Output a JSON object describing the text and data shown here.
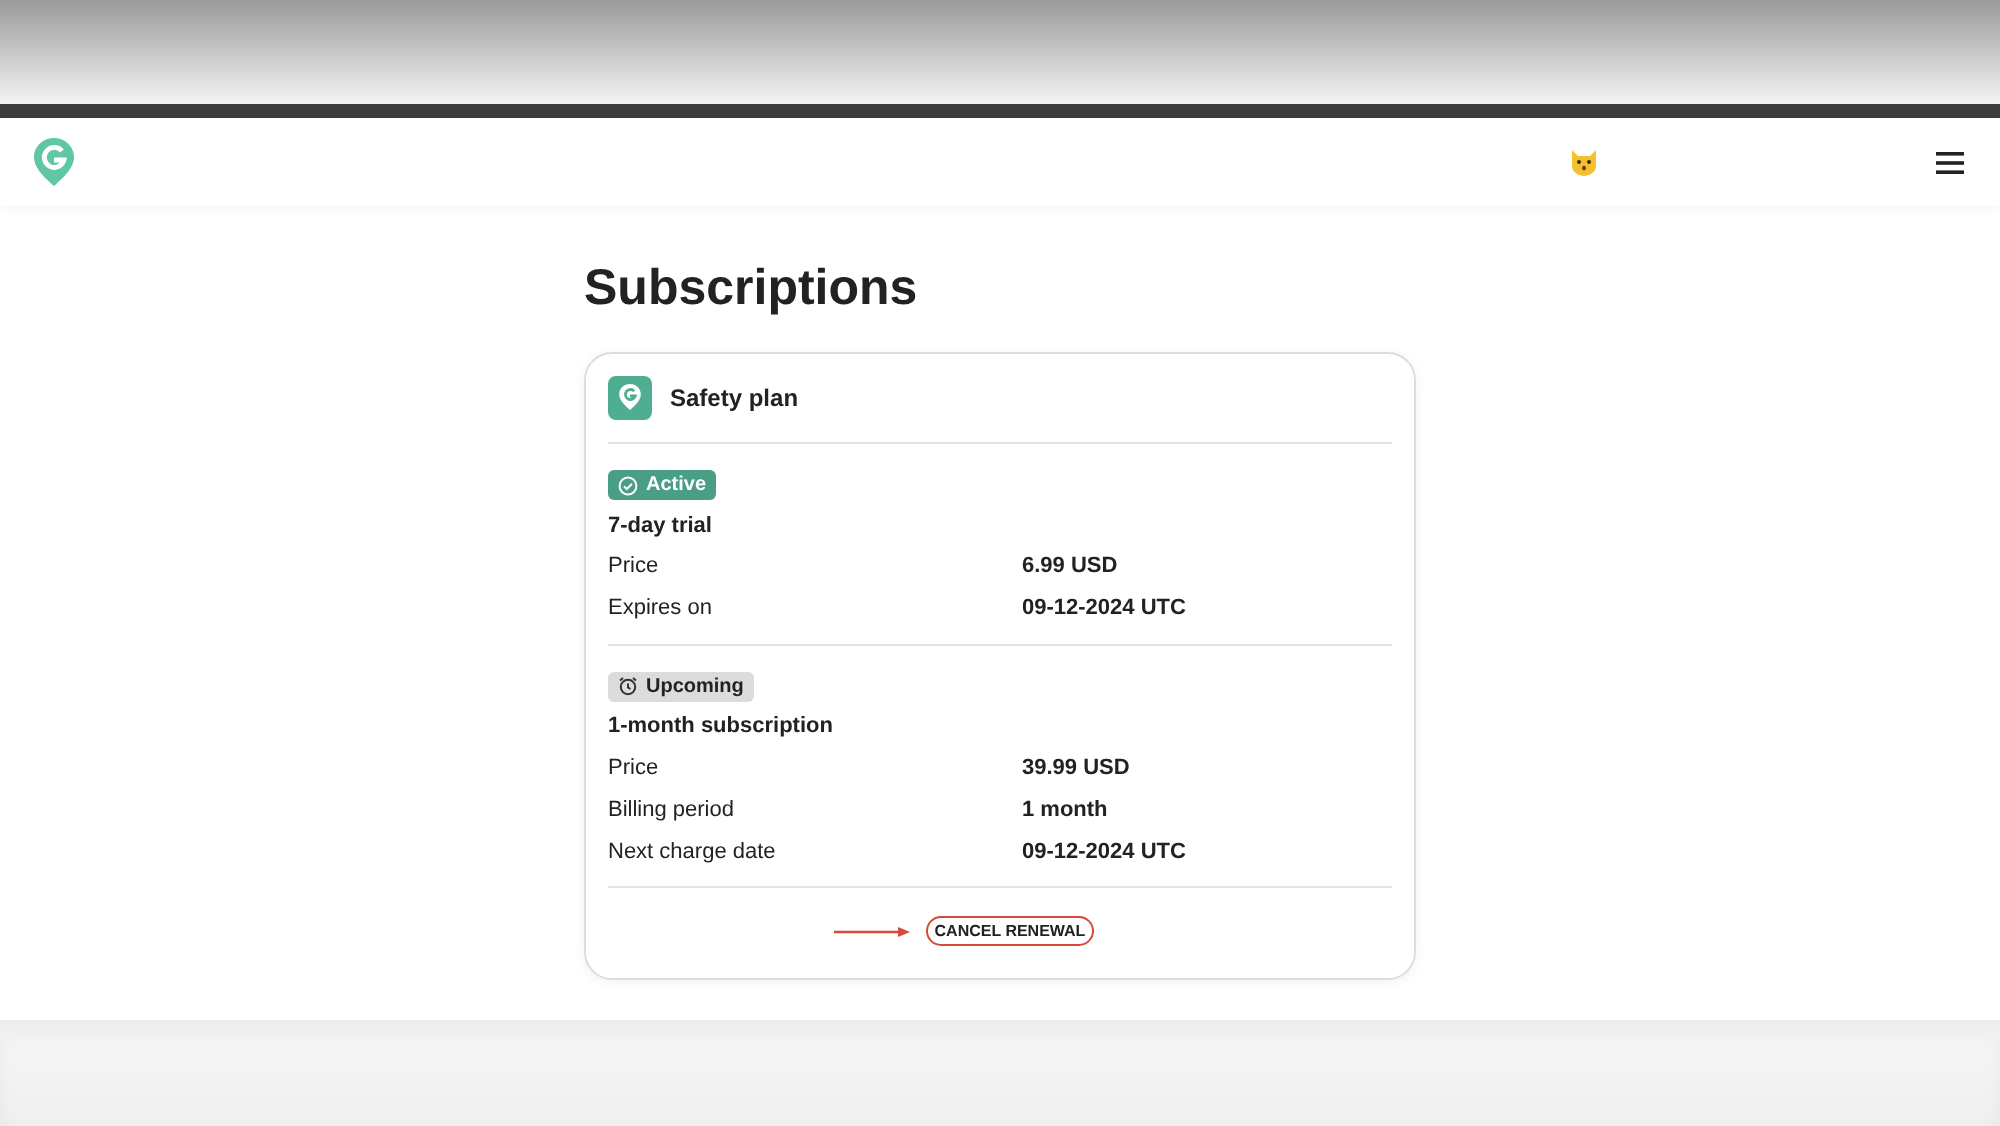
{
  "page": {
    "title": "Subscriptions"
  },
  "card": {
    "plan_name": "Safety plan",
    "periods": [
      {
        "status": {
          "kind": "active",
          "label": "Active"
        },
        "name": "7-day trial",
        "rows": [
          {
            "label": "Price",
            "value": "6.99 USD"
          },
          {
            "label": "Expires on",
            "value": "09-12-2024 UTC"
          }
        ]
      },
      {
        "status": {
          "kind": "upcoming",
          "label": "Upcoming"
        },
        "name": "1-month subscription",
        "rows": [
          {
            "label": "Price",
            "value": "39.99 USD"
          },
          {
            "label": "Billing period",
            "value": "1 month"
          },
          {
            "label": "Next charge date",
            "value": "09-12-2024 UTC"
          }
        ]
      }
    ],
    "cancel_button": {
      "label": "CANCEL RENEWAL",
      "highlighted": true
    }
  }
}
